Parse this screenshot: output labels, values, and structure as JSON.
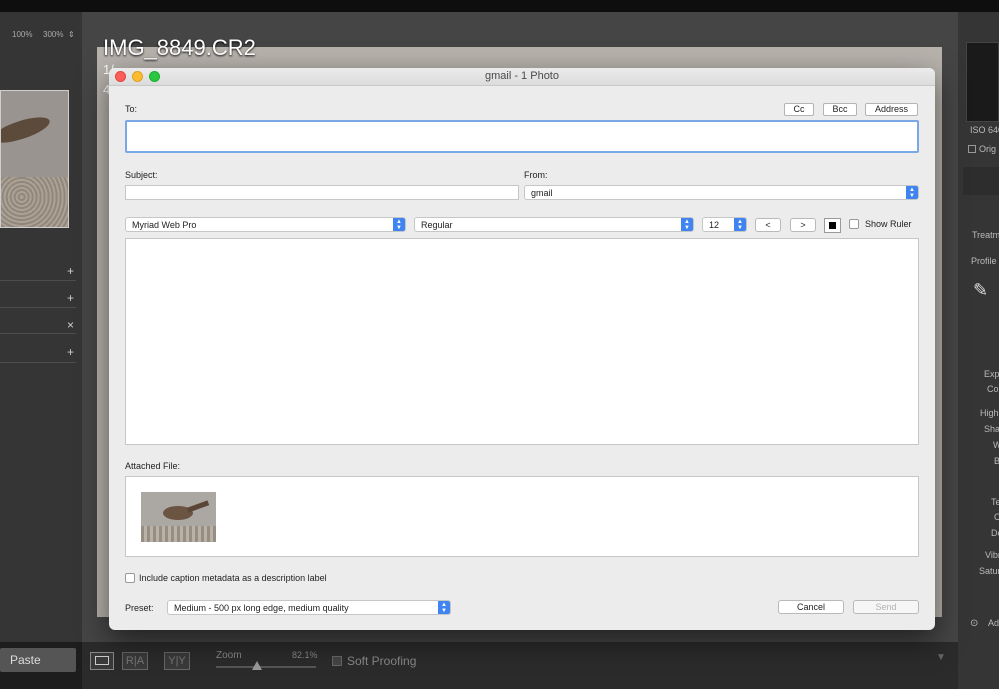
{
  "lightroom": {
    "zoom_100": "100%",
    "zoom_300": "300%",
    "photo_title": "IMG_8849.CR2",
    "photo_sub_1": "1/",
    "photo_sub_2": "4",
    "paste_label": "Paste",
    "zoom_label": "Zoom",
    "zoom_value": "82.1%",
    "soft_proofing_label": "Soft Proofing",
    "view_ra": "R|A",
    "view_yy": "Y|Y",
    "plus_symbol": "+",
    "close_symbol": "×",
    "right_panel": {
      "iso": "ISO 640",
      "original": "Orig",
      "treatment": "Treatm",
      "profile": "Profile :",
      "exposure": "Expo",
      "contrast": "Con",
      "highlights": "High",
      "shadows": "Shad",
      "whites": "W",
      "blacks": "B",
      "texture": "Te",
      "clarity": "C",
      "dehaze": "De",
      "vibrance": "Vibr",
      "saturation": "Satur",
      "adjust": "Ad"
    }
  },
  "dialog": {
    "title": "gmail - 1 Photo",
    "to_label": "To:",
    "cc_label": "Cc",
    "bcc_label": "Bcc",
    "address_label": "Address",
    "subject_label": "Subject:",
    "subject_value": "",
    "from_label": "From:",
    "from_value": "gmail",
    "font_family": "Myriad Web Pro",
    "font_style": "Regular",
    "font_size": "12",
    "align_left_label": "<",
    "align_right_label": ">",
    "show_ruler_label": "Show Ruler",
    "attached_file_label": "Attached File:",
    "include_caption_label": "Include caption metadata as a description label",
    "preset_label": "Preset:",
    "preset_value": "Medium - 500 px long edge, medium quality",
    "cancel_label": "Cancel",
    "send_label": "Send"
  },
  "colors": {
    "accent": "#3f84f1",
    "focus_ring": "#7aa7e6",
    "close": "#fc5f57",
    "minimize": "#fdbc2e",
    "zoom": "#27c840"
  }
}
